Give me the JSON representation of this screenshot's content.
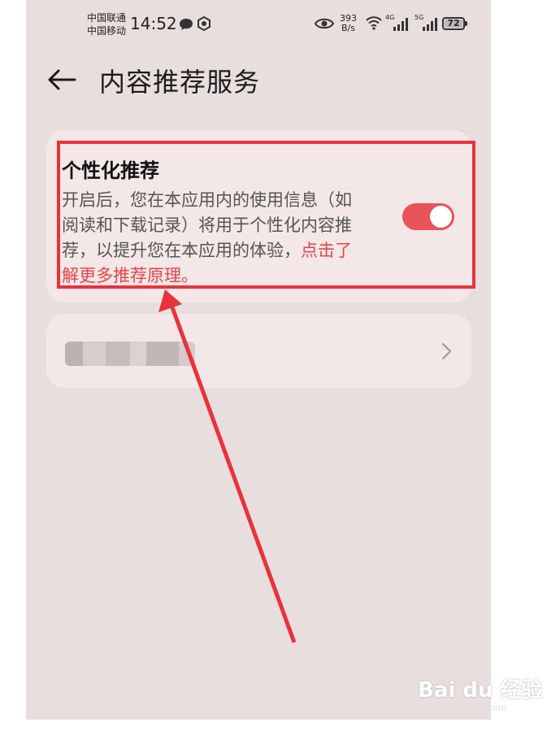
{
  "status_bar": {
    "carrier1": "中国联通",
    "carrier2": "中国移动",
    "time": "14:52",
    "net_speed_value": "393",
    "net_speed_unit": "B/s",
    "network1": "4G",
    "network2": "5G",
    "battery": "72"
  },
  "header": {
    "title": "内容推荐服务"
  },
  "personalized": {
    "title": "个性化推荐",
    "desc_line1": "开启后，您在本应用内的使用信息（如",
    "desc_line2": "阅读和下载记录）将用于个性化内容推",
    "desc_line3_text": "荐，以提升您在本应用的体验，",
    "desc_line3_link": "点击了",
    "desc_line4_link": "解更多推荐原理。",
    "toggle_on": true,
    "accent_color": "#e85458"
  },
  "watermark": {
    "brand": "Bai du 经验",
    "url": "jingyan.baidu.com"
  }
}
